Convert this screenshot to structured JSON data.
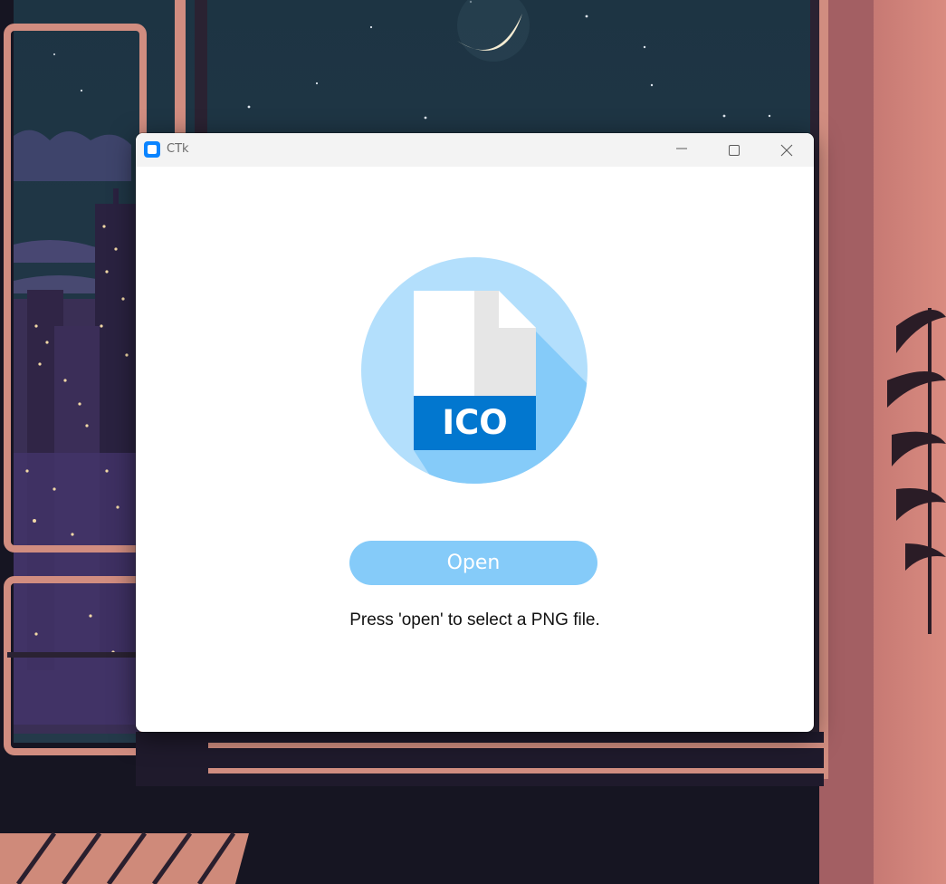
{
  "window": {
    "title": "CTk",
    "controls": [
      "minimize-icon",
      "maximize-icon",
      "close-icon"
    ]
  },
  "logo": {
    "label": "ICO",
    "icon": "ico-file-icon",
    "colors": {
      "circle": "#b3dffc",
      "shadow": "#85cbf9",
      "band": "#0277cf",
      "page": "#ffffff",
      "fold": "#e6e6e6"
    }
  },
  "main": {
    "open_button_label": "Open",
    "status_text": "Press 'open' to select a PNG file."
  },
  "colors": {
    "accent": "#85cbf9",
    "titlebar": "#f3f3f3",
    "app_icon": "#0a84ff"
  }
}
